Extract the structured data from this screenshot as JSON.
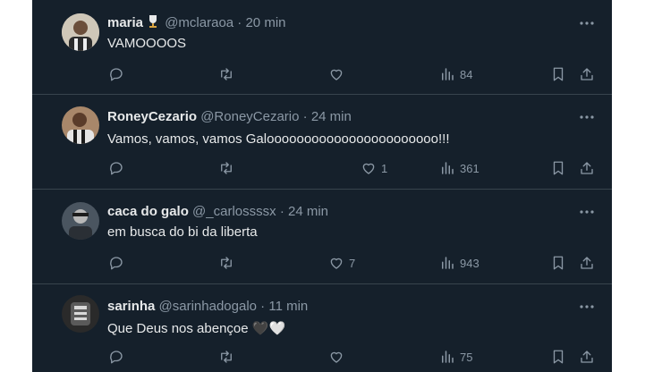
{
  "tweets": [
    {
      "name": "maria",
      "badge_icon": "trophy-icon",
      "handle": "@mclaraoa",
      "time": "20 min",
      "text": "VAMOOOOS",
      "likes": "",
      "views": "84"
    },
    {
      "name": "RoneyCezario",
      "handle": "@RoneyCezario",
      "time": "24 min",
      "text": "Vamos, vamos, vamos Galooooooooooooooooooooooo!!!",
      "likes": "1",
      "views": "361"
    },
    {
      "name": "caca do galo",
      "handle": "@_carlossssx",
      "time": "24 min",
      "text": "em busca do bi da liberta",
      "likes": "7",
      "views": "943"
    },
    {
      "name": "sarinha",
      "handle": "@sarinhadogalo",
      "time": "11 min",
      "text": "Que Deus nos abençoe 🖤🤍",
      "likes": "",
      "views": "75"
    }
  ],
  "colors": {
    "background": "#15202b",
    "text_primary": "#e7e9ea",
    "text_secondary": "#8b98a5",
    "divider": "#38444d"
  },
  "icons": [
    "reply-icon",
    "retweet-icon",
    "like-icon",
    "views-icon",
    "bookmark-icon",
    "share-icon",
    "more-icon"
  ]
}
